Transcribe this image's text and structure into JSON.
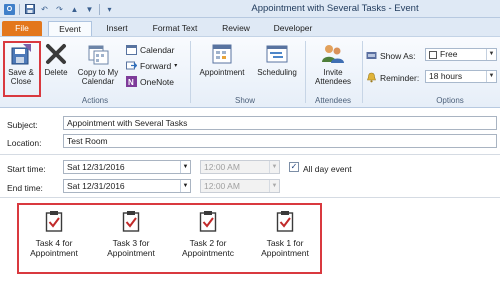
{
  "window": {
    "title": "Appointment with Several Tasks  -  Event"
  },
  "tabs": [
    "File",
    "Event",
    "Insert",
    "Format Text",
    "Review",
    "Developer"
  ],
  "ribbon": {
    "actions": {
      "save_close": "Save & Close",
      "delete": "Delete",
      "copy_calendar": "Copy to My Calendar",
      "calendar": "Calendar",
      "forward": "Forward",
      "onenote": "OneNote",
      "group_label": "Actions"
    },
    "show": {
      "appointment": "Appointment",
      "scheduling": "Scheduling",
      "group_label": "Show"
    },
    "attendees": {
      "invite": "Invite Attendees",
      "group_label": "Attendees"
    },
    "options": {
      "show_as_label": "Show As:",
      "show_as_value": "Free",
      "reminder_label": "Reminder:",
      "reminder_value": "18 hours",
      "group_label": "Options"
    }
  },
  "form": {
    "subject_label": "Subject:",
    "subject_value": "Appointment with Several Tasks",
    "location_label": "Location:",
    "location_value": "Test Room",
    "start_label": "Start time:",
    "start_date": "Sat 12/31/2016",
    "start_time": "12:00 AM",
    "end_label": "End time:",
    "end_date": "Sat 12/31/2016",
    "end_time": "12:00 AM",
    "all_day_label": "All day event",
    "all_day_checked": true
  },
  "attachments": [
    {
      "line1": "Task 4 for",
      "line2": "Appointment"
    },
    {
      "line1": "Task 3 for",
      "line2": "Appointment"
    },
    {
      "line1": "Task 2 for",
      "line2": "Appointmentc"
    },
    {
      "line1": "Task 1 for",
      "line2": "Appointment"
    }
  ],
  "colors": {
    "file_tab": "#e3771c",
    "highlight_box": "#d9393f",
    "active_button": "#f9c94e"
  }
}
